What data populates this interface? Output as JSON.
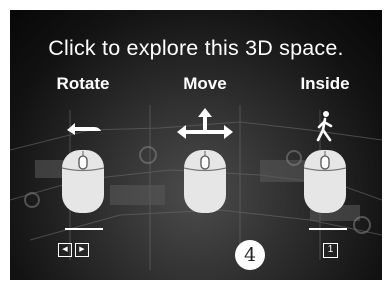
{
  "instruction": "Click to explore this 3D space.",
  "modes": [
    {
      "label": "Rotate",
      "icon": "left-arrow-mouse-icon"
    },
    {
      "label": "Move",
      "icon": "four-way-arrow-mouse-icon"
    },
    {
      "label": "Inside",
      "icon": "walking-person-mouse-icon"
    }
  ],
  "keys": {
    "rotate": {
      "left": "◀",
      "right": "▶"
    },
    "move_badge": "4",
    "inside": "1"
  },
  "colors": {
    "overlay": "#141414",
    "foreground": "#ffffff",
    "mouse_body": "#e6e6e6"
  }
}
